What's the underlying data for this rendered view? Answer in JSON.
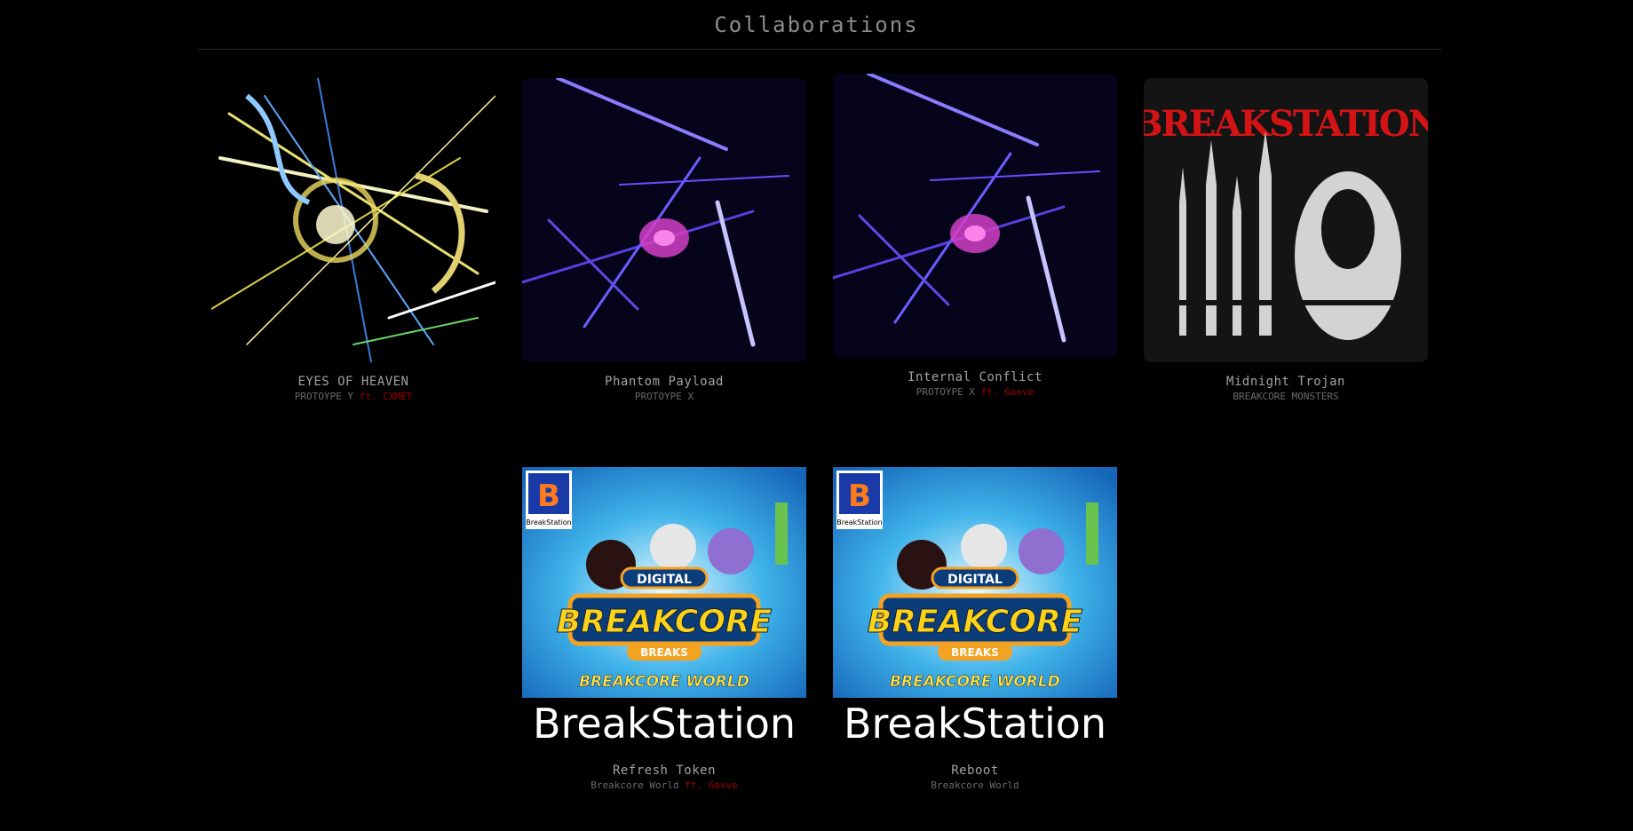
{
  "page": {
    "title": "Collaborations"
  },
  "tracks": [
    {
      "title": "EYES OF HEAVEN",
      "artist": "PROTOYPE Y",
      "feat": "ft. CXMET"
    },
    {
      "title": "Phantom Payload",
      "artist": "PROTOYPE X",
      "feat": ""
    },
    {
      "title": "Internal Conflict",
      "artist": "PROTOYPE X",
      "feat": "ft. Gaxve"
    },
    {
      "title": "Midnight Trojan",
      "artist": "BREAKCORE MONSTERS",
      "feat": ""
    },
    {
      "title": "Refresh Token",
      "artist": "Breakcore World",
      "feat": "ft. Gaxve"
    },
    {
      "title": "Reboot",
      "artist": "Breakcore World",
      "feat": ""
    }
  ],
  "artwork": {
    "breakcore": {
      "badge": "DIGITAL",
      "logo": "BREAKCORE",
      "ribbon": "BREAKS",
      "banner": "BREAKCORE WORLD",
      "brand": "BreakStation",
      "corner_letter": "B",
      "corner_label": "BreakStation"
    },
    "monsters_logo": "BREAKSTATION"
  }
}
